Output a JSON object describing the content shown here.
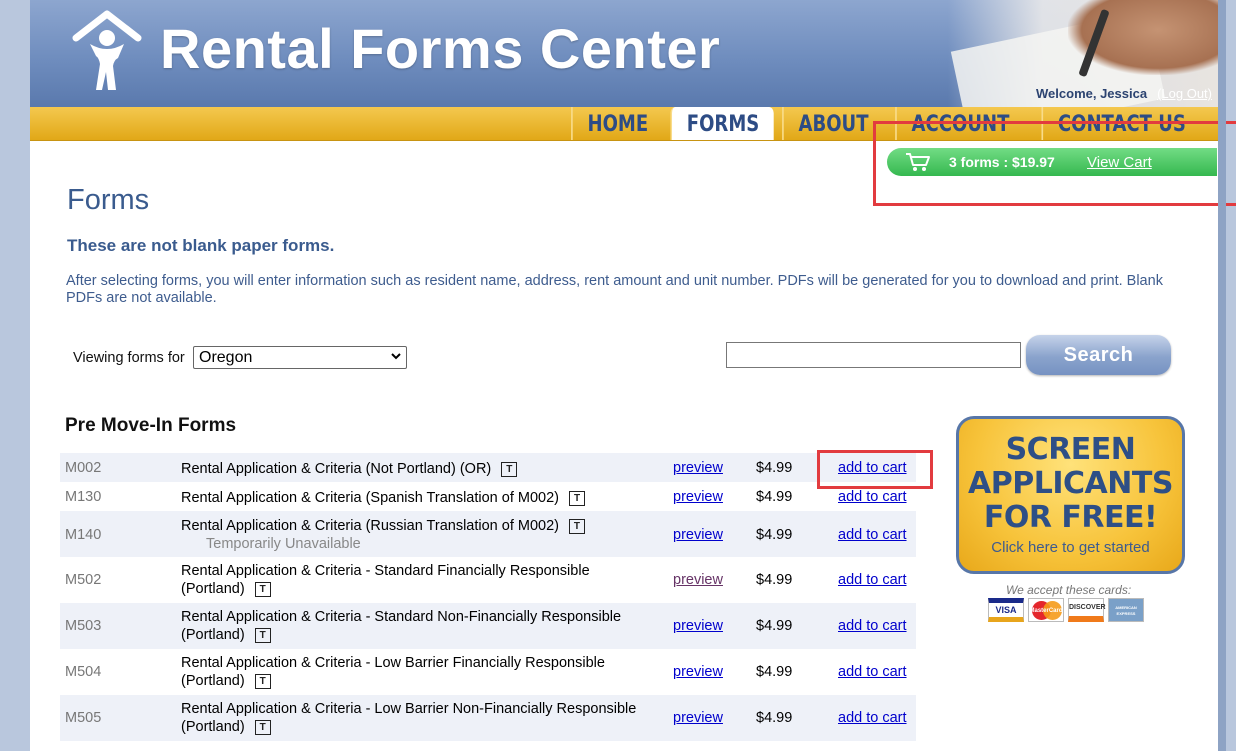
{
  "header": {
    "site_title": "Rental Forms Center",
    "welcome": "Welcome, Jessica",
    "logout": "(Log Out)"
  },
  "nav": {
    "items": [
      "HOME",
      "FORMS",
      "ABOUT",
      "ACCOUNT",
      "CONTACT US"
    ],
    "active": "FORMS"
  },
  "cart": {
    "summary": "3 forms : $19.97",
    "view_label": "View Cart"
  },
  "page": {
    "title": "Forms",
    "subhead": "These are not blank paper forms.",
    "intro": "After selecting forms, you will enter information such as resident name, address, rent amount and unit number. PDFs will be generated for you to download and print. Blank PDFs are not available."
  },
  "filter": {
    "label": "Viewing forms for",
    "state_selected": "Oregon"
  },
  "search": {
    "value": "",
    "button_label": "Search"
  },
  "section": {
    "title": "Pre Move-In Forms"
  },
  "forms": [
    {
      "code": "M002",
      "name_l1": "Rental Application & Criteria (Not Portland) (OR)",
      "name_l2": "",
      "note": "",
      "preview": "preview",
      "price": "$4.99",
      "add": "add to cart"
    },
    {
      "code": "M130",
      "name_l1": "Rental Application & Criteria (Spanish Translation of M002)",
      "name_l2": "",
      "note": "",
      "preview": "preview",
      "price": "$4.99",
      "add": "add to cart"
    },
    {
      "code": "M140",
      "name_l1": "Rental Application & Criteria (Russian Translation of M002)",
      "name_l2": "",
      "note": "Temporarily Unavailable",
      "preview": "preview",
      "price": "$4.99",
      "add": "add to cart"
    },
    {
      "code": "M502",
      "name_l1": "Rental Application & Criteria - Standard Financially Responsible",
      "name_l2": "(Portland)",
      "note": "",
      "preview": "preview",
      "price": "$4.99",
      "add": "add to cart"
    },
    {
      "code": "M503",
      "name_l1": "Rental Application & Criteria - Standard Non-Financially Responsible",
      "name_l2": "(Portland)",
      "note": "",
      "preview": "preview",
      "price": "$4.99",
      "add": "add to cart"
    },
    {
      "code": "M504",
      "name_l1": "Rental Application & Criteria - Low Barrier Financially Responsible",
      "name_l2": "(Portland)",
      "note": "",
      "preview": "preview",
      "price": "$4.99",
      "add": "add to cart"
    },
    {
      "code": "M505",
      "name_l1": "Rental Application & Criteria - Low Barrier Non-Financially Responsible",
      "name_l2": "(Portland)",
      "note": "",
      "preview": "preview",
      "price": "$4.99",
      "add": "add to cart"
    }
  ],
  "promo": {
    "lines": [
      "SCREEN",
      "APPLICANTS",
      "FOR FREE!"
    ],
    "sub": "Click here to get started"
  },
  "payment": {
    "caption": "We accept these cards:",
    "cards": [
      "VISA",
      "MasterCard",
      "DISCOVER",
      "AMERICAN EXPRESS"
    ]
  },
  "colors": {
    "nav_text": "#2d4c85",
    "cart_green": "#35b84f",
    "highlight_red": "#e23b3f",
    "heading_blue": "#3a5b8e"
  }
}
